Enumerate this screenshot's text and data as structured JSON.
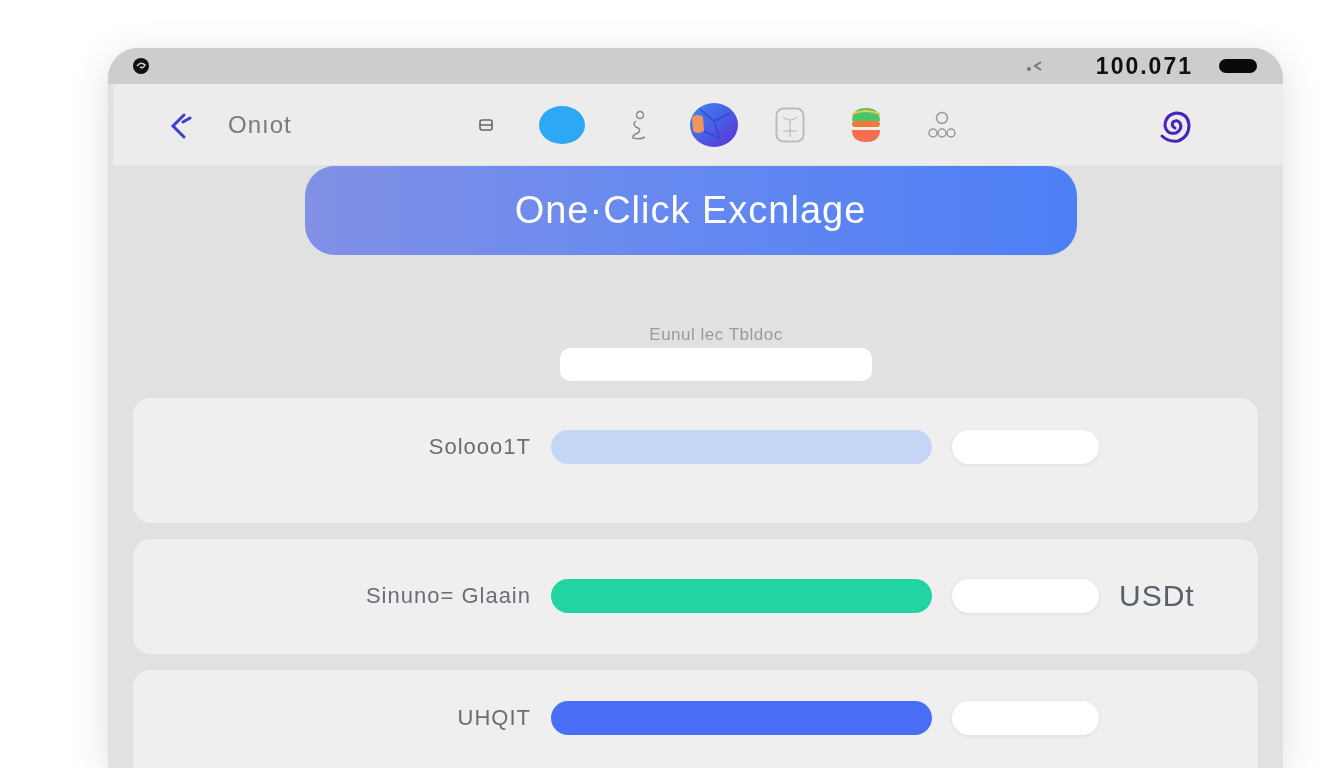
{
  "status_bar": {
    "reading": "100.071"
  },
  "nav_bar": {
    "title": "Onıot"
  },
  "exchange_button": {
    "label": "One·Click Excnlage"
  },
  "amount_field": {
    "label": "Eunul lec Tbldoc"
  },
  "rows": [
    {
      "label": "Solooo1T",
      "color": "#c5d5f5"
    },
    {
      "label": "Sinuno= Glaain",
      "color": "#22d4a2",
      "unit": "USDt"
    },
    {
      "label": "UHQIT",
      "color": "#4a6ef5"
    }
  ]
}
